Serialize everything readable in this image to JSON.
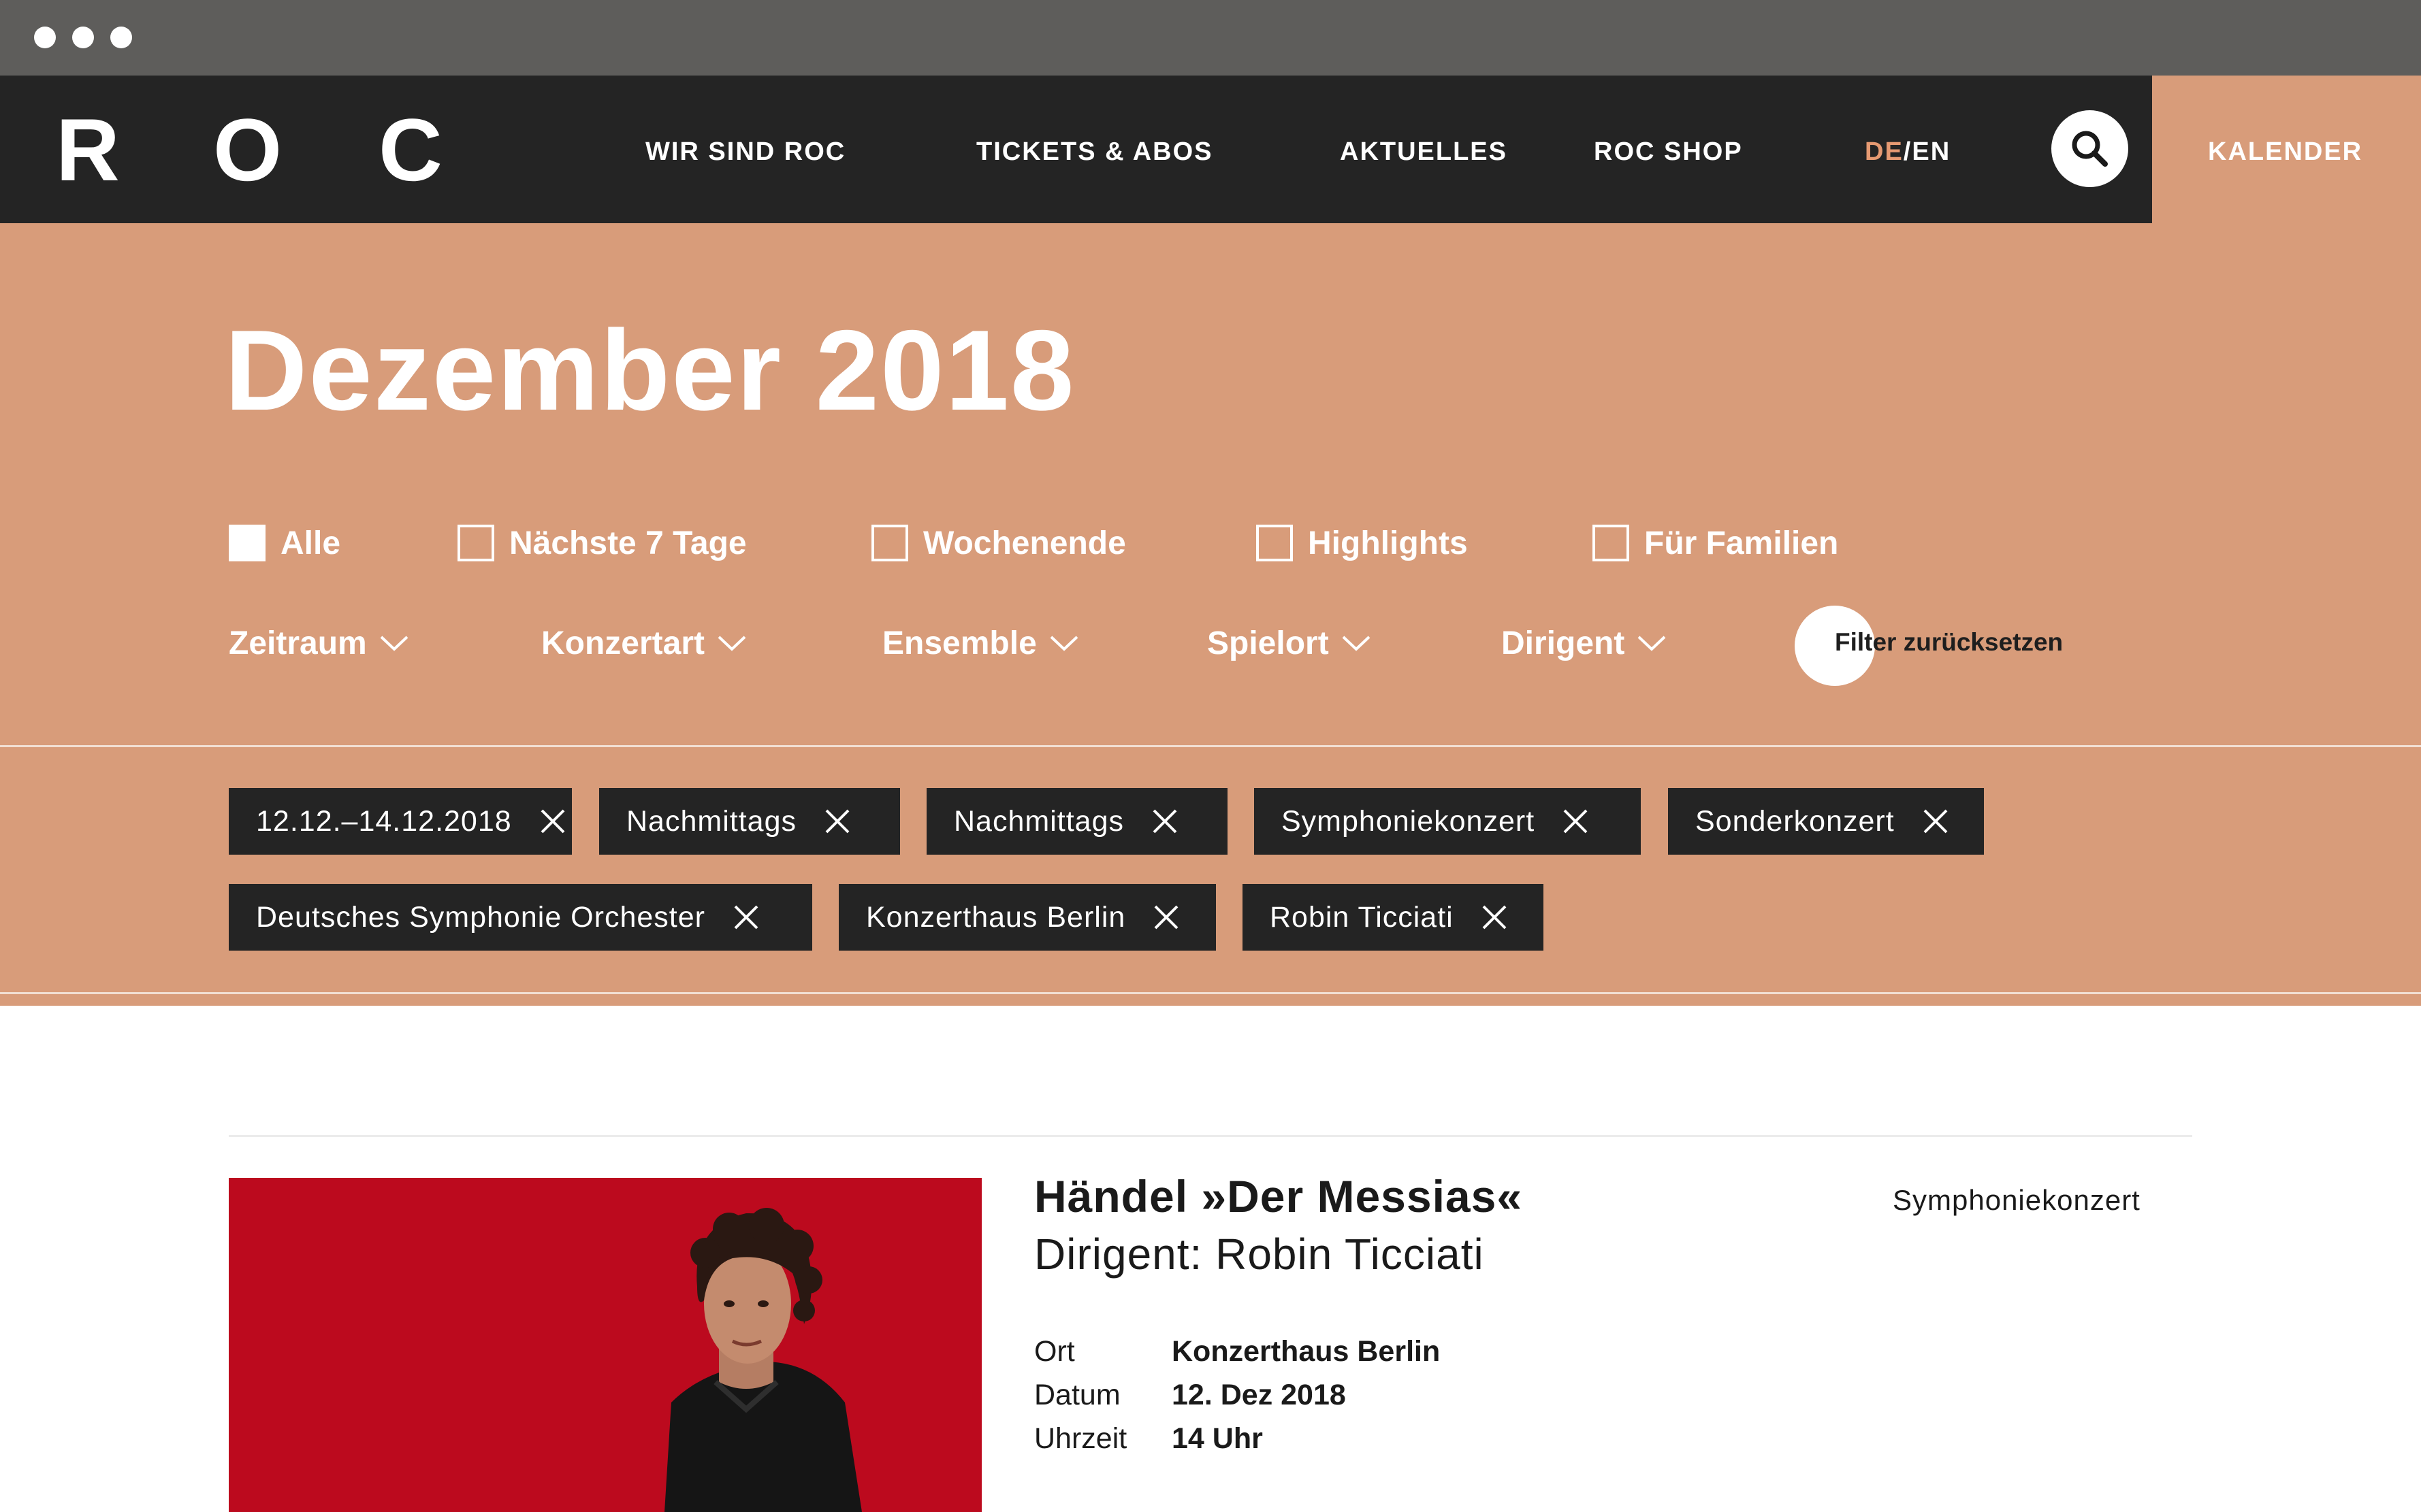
{
  "brand": {
    "letters": [
      "R",
      "O",
      "C"
    ]
  },
  "nav": {
    "items": [
      "WIR SIND ROC",
      "TICKETS & ABOS",
      "AKTUELLES",
      "ROC SHOP"
    ],
    "lang_de": "DE",
    "lang_sep": "/",
    "lang_en": "EN",
    "search_icon": "search-icon",
    "kalender": "KALENDER"
  },
  "page": {
    "title": "Dezember 2018"
  },
  "quick_filters": [
    {
      "label": "Alle",
      "checked": true
    },
    {
      "label": "Nächste 7 Tage",
      "checked": false
    },
    {
      "label": "Wochenende",
      "checked": false
    },
    {
      "label": "Highlights",
      "checked": false
    },
    {
      "label": "Für Familien",
      "checked": false
    }
  ],
  "dropdowns": [
    "Zeitraum",
    "Konzertart",
    "Ensemble",
    "Spielort",
    "Dirigent"
  ],
  "reset_label": "Filter zurücksetzen",
  "active_tags": [
    "12.12.–14.12.2018",
    "Nachmittags",
    "Nachmittags",
    "Symphoniekonzert",
    "Sonderkonzert",
    "Deutsches Symphonie Orchester",
    "Konzerthaus Berlin",
    "Robin Ticciati"
  ],
  "event": {
    "title": "Händel »Der Messias«",
    "subtitle": "Dirigent: Robin Ticciati",
    "category": "Symphoniekonzert",
    "meta": [
      {
        "label": "Ort",
        "value": "Konzerthaus Berlin"
      },
      {
        "label": "Datum",
        "value": "12. Dez 2018"
      },
      {
        "label": "Uhrzeit",
        "value": "14 Uhr"
      }
    ]
  },
  "colors": {
    "accent": "#d89c7a",
    "dark": "#242424",
    "lang_active": "#e69a72",
    "photo_bg": "#bc0a1e"
  }
}
